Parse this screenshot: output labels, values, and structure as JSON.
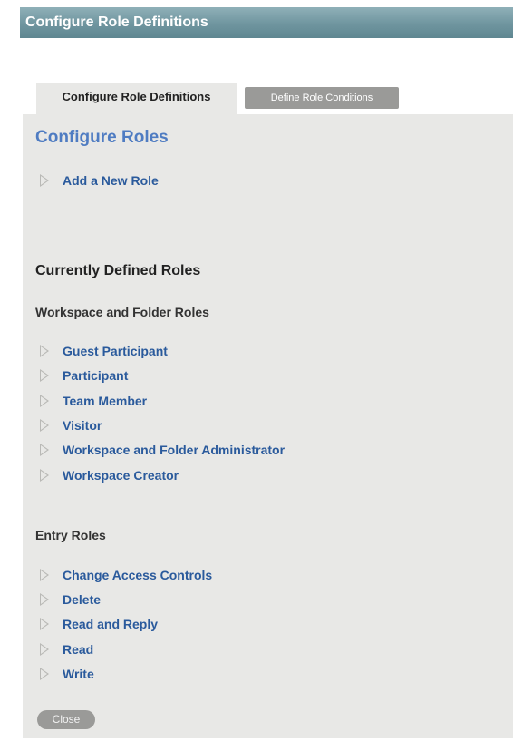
{
  "window": {
    "title": "Configure Role Definitions"
  },
  "tabs": [
    {
      "label": "Configure Role Definitions",
      "active": true
    },
    {
      "label": "Define Role Conditions",
      "active": false
    }
  ],
  "configure": {
    "heading": "Configure Roles",
    "add_role": "Add a New Role"
  },
  "defined": {
    "heading": "Currently Defined Roles",
    "workspace_section": "Workspace and Folder Roles",
    "workspace_roles": [
      "Guest Participant",
      "Participant",
      "Team Member",
      "Visitor",
      "Workspace and Folder Administrator",
      "Workspace Creator"
    ],
    "entry_section": "Entry Roles",
    "entry_roles": [
      "Change Access Controls",
      "Delete",
      "Read and Reply",
      "Read",
      "Write"
    ]
  },
  "close_label": "Close",
  "colors": {
    "title_bar": "#6f959f",
    "heading_blue": "#4f7cc2",
    "link_blue": "#2a5a9c",
    "panel_bg": "#e8e8e6",
    "button_gray": "#9a9a98"
  }
}
